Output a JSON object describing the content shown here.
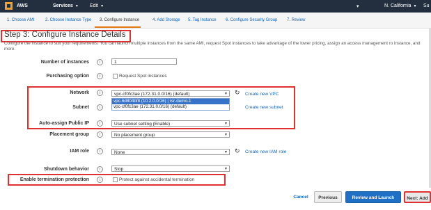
{
  "topbar": {
    "brand": "AWS",
    "services": "Services",
    "edit": "Edit",
    "region": "N. California",
    "user": "Su"
  },
  "steps": [
    "1. Choose AMI",
    "2. Choose Instance Type",
    "3. Configure Instance",
    "4. Add Storage",
    "5. Tag Instance",
    "6. Configure Security Group",
    "7. Review"
  ],
  "page": {
    "title": "Step 3: Configure Instance Details",
    "intro": "Configure the instance to suit your requirements. You can launch multiple instances from the same AMI, request Spot instances to take advantage of the lower pricing, assign an access management ro instance, and more."
  },
  "form": {
    "instances": {
      "label": "Number of instances",
      "value": "1"
    },
    "purchasing": {
      "label": "Purchasing option",
      "checkbox": "Request Spot instances"
    },
    "network": {
      "label": "Network",
      "value": "vpc-cf0fc3ae (172.31.0.0/16) (default)",
      "link": "Create new VPC",
      "options": [
        "vpc-6d804bf8 (10.2.0.0/16) | rsr-demo-1",
        "vpc-cf0fc3ae (172.31.0.0/16) (default)"
      ]
    },
    "subnet": {
      "label": "Subnet",
      "link": "Create new subnet"
    },
    "public_ip": {
      "label": "Auto-assign Public IP",
      "value": "Use subnet setting (Enable)"
    },
    "placement": {
      "label": "Placement group",
      "value": "No placement group"
    },
    "iam": {
      "label": "IAM role",
      "value": "None",
      "link": "Create new IAM role"
    },
    "shutdown": {
      "label": "Shutdown behavior",
      "value": "Stop"
    },
    "termination": {
      "label": "Enable termination protection",
      "checkbox": "Protect against accidental termination"
    }
  },
  "buttons": {
    "cancel": "Cancel",
    "previous": "Previous",
    "review": "Review and Launch",
    "next": "Next: Add"
  },
  "colors": {
    "accent": "#e47911",
    "link": "#1166bb",
    "highlight": "#e03030",
    "primary": "#1f6fc5"
  }
}
